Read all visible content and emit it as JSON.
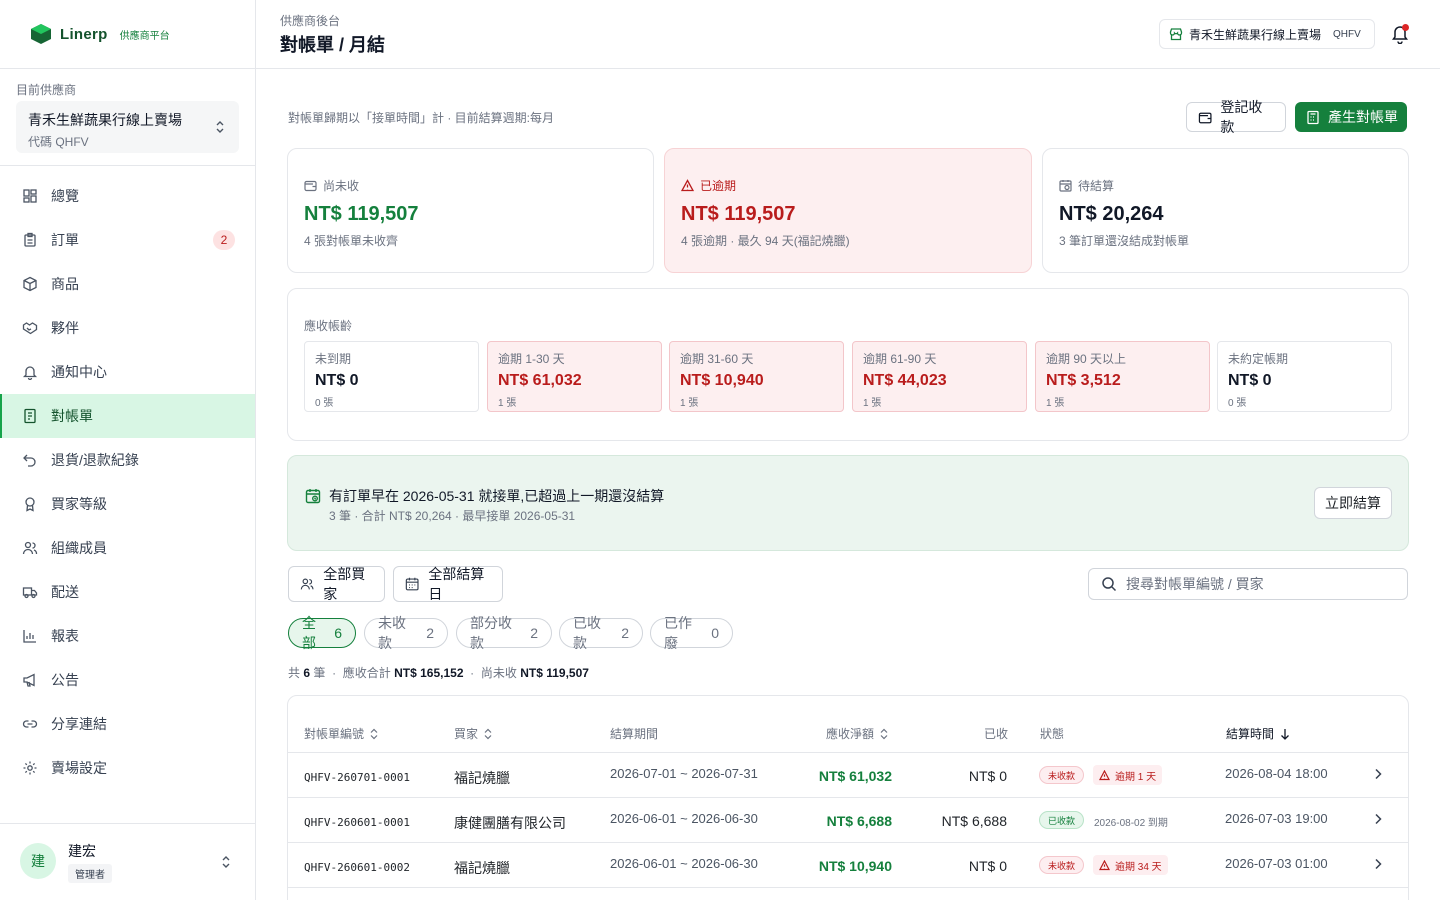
{
  "brand": {
    "name": "Linerp",
    "subtitle": "供應商平台"
  },
  "sidebar": {
    "vendor_label": "目前供應商",
    "vendor_name": "青禾生鮮蔬果行線上賣場",
    "vendor_code": "代碼 QHFV",
    "items": [
      {
        "label": "總覽",
        "icon": "dashboard-icon"
      },
      {
        "label": "訂單",
        "icon": "clipboard-icon",
        "badge": "2"
      },
      {
        "label": "商品",
        "icon": "box-icon"
      },
      {
        "label": "夥伴",
        "icon": "handshake-icon"
      },
      {
        "label": "通知中心",
        "icon": "bell-icon"
      },
      {
        "label": "對帳單",
        "icon": "invoice-icon",
        "active": true
      },
      {
        "label": "退貨/退款紀錄",
        "icon": "undo-icon"
      },
      {
        "label": "買家等級",
        "icon": "medal-icon"
      },
      {
        "label": "組織成員",
        "icon": "users-icon"
      },
      {
        "label": "配送",
        "icon": "truck-icon"
      },
      {
        "label": "報表",
        "icon": "bar-chart-icon"
      },
      {
        "label": "公告",
        "icon": "megaphone-icon"
      },
      {
        "label": "分享連結",
        "icon": "link-icon"
      },
      {
        "label": "賣場設定",
        "icon": "gear-icon"
      }
    ],
    "user": {
      "initial": "建",
      "name": "建宏",
      "role": "管理者"
    }
  },
  "header": {
    "breadcrumb": "供應商後台",
    "title": "對帳單 / 月結",
    "store_name": "青禾生鮮蔬果行線上賣場",
    "store_code": "QHFV"
  },
  "main": {
    "note": "對帳單歸期以「接單時間」計 · 目前結算週期:每月",
    "record_payment_label": "登記收款",
    "generate_label": "產生對帳單",
    "cards": [
      {
        "label": "尚未收",
        "value": "NT$ 119,507",
        "sub": "4 張對帳單未收齊",
        "color": "#15803d"
      },
      {
        "label": "已逾期",
        "value": "NT$ 119,507",
        "sub": "4 張逾期 · 最久 94 天(福記燒臘)",
        "color": "#b91c1c"
      },
      {
        "label": "待結算",
        "value": "NT$ 20,264",
        "sub": "3 筆訂單還沒結成對帳單",
        "color": "#111827"
      }
    ],
    "aging": {
      "title": "應收帳齡",
      "buckets": [
        {
          "label": "未到期",
          "value": "NT$ 0",
          "count": "0 張"
        },
        {
          "label": "逾期 1-30 天",
          "value": "NT$ 61,032",
          "count": "1 張"
        },
        {
          "label": "逾期 31-60 天",
          "value": "NT$ 10,940",
          "count": "1 張"
        },
        {
          "label": "逾期 61-90 天",
          "value": "NT$ 44,023",
          "count": "1 張"
        },
        {
          "label": "逾期 90 天以上",
          "value": "NT$ 3,512",
          "count": "1 張"
        },
        {
          "label": "未約定帳期",
          "value": "NT$ 0",
          "count": "0 張"
        }
      ]
    },
    "alert": {
      "title": "有訂單早在 2026-05-31 就接單,已超過上一期還沒結算",
      "sub": "3 筆 · 合計 NT$ 20,264 · 最早接單 2026-05-31",
      "button": "立即結算"
    },
    "filters": {
      "buyer": "全部買家",
      "settle_day": "全部結算日",
      "search_placeholder": "搜尋對帳單編號 / 買家"
    },
    "tabs": [
      {
        "label": "全部",
        "count": "6"
      },
      {
        "label": "未收款",
        "count": "2"
      },
      {
        "label": "部分收款",
        "count": "2"
      },
      {
        "label": "已收款",
        "count": "2"
      },
      {
        "label": "已作廢",
        "count": "0"
      }
    ],
    "summary": {
      "total_prefix": "共",
      "total_count": "6",
      "total_suffix": "筆",
      "receivable_label": "應收合計",
      "receivable": "NT$ 165,152",
      "unpaid_label": "尚未收",
      "unpaid": "NT$ 119,507",
      "sep": "·"
    },
    "table": {
      "headers": [
        "對帳單編號",
        "買家",
        "結算期間",
        "應收淨額",
        "已收",
        "狀態",
        "結算時間"
      ],
      "rows": [
        {
          "id": "QHFV-260701-0001",
          "buyer": "福記燒臘",
          "period": "2026-07-01 ~ 2026-07-31",
          "net": "NT$ 61,032",
          "paid": "NT$ 0",
          "status": "未收款",
          "status_type": "unpaid",
          "extra": "逾期 1 天",
          "settled": "2026-08-04 18:00"
        },
        {
          "id": "QHFV-260601-0001",
          "buyer": "康健團膳有限公司",
          "period": "2026-06-01 ~ 2026-06-30",
          "net": "NT$ 6,688",
          "paid": "NT$ 6,688",
          "status": "已收款",
          "status_type": "paid",
          "extra": "2026-08-02 到期",
          "settled": "2026-07-03 19:00"
        },
        {
          "id": "QHFV-260601-0002",
          "buyer": "福記燒臘",
          "period": "2026-06-01 ~ 2026-06-30",
          "net": "NT$ 10,940",
          "paid": "NT$ 0",
          "status": "未收款",
          "status_type": "unpaid",
          "extra": "逾期 34 天",
          "settled": "2026-07-03 01:00"
        }
      ]
    }
  }
}
